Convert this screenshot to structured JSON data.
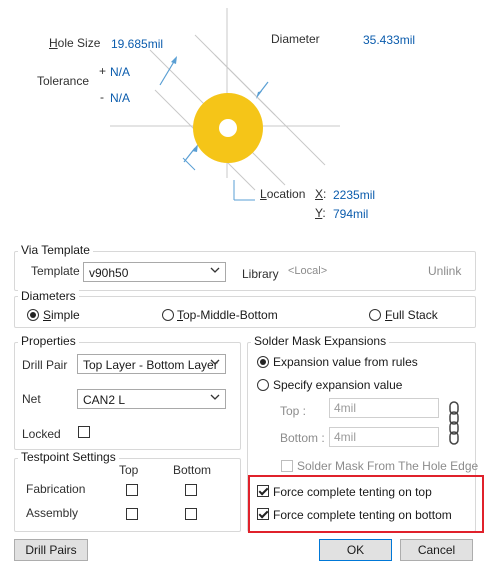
{
  "hole": {
    "hole_size_label": "Hole Size",
    "hole_size_value": "19.685mil",
    "tolerance_label": "Tolerance",
    "tol_plus_sign": "+",
    "tol_plus_value": "N/A",
    "tol_minus_sign": "-",
    "tol_minus_value": "N/A",
    "diameter_label": "Diameter",
    "diameter_value": "35.433mil",
    "location_label": "Location",
    "x_label": "X:",
    "x_value": "2235mil",
    "y_label": "Y:",
    "y_value": "794mil"
  },
  "via_template": {
    "title": "Via Template",
    "template_label": "Template",
    "template_value": "v90h50",
    "library_label": "Library",
    "library_value": "<Local>",
    "unlink_label": "Unlink"
  },
  "diameters": {
    "title": "Diameters",
    "simple": "Simple",
    "top_middle_bottom": "Top-Middle-Bottom",
    "full_stack": "Full Stack",
    "selected": "Simple"
  },
  "properties": {
    "title": "Properties",
    "drill_pair_label": "Drill Pair",
    "drill_pair_value": "Top Layer - Bottom Layer",
    "net_label": "Net",
    "net_value": "CAN2 L",
    "locked_label": "Locked",
    "locked_checked": false
  },
  "solder_mask": {
    "title": "Solder Mask Expansions",
    "rules_label": "Expansion value from rules",
    "specify_label": "Specify expansion value",
    "selected": "Expansion value from rules",
    "top_label": "Top :",
    "top_value": "4mil",
    "bottom_label": "Bottom :",
    "bottom_value": "4mil",
    "from_hole_label": "Solder Mask From The Hole Edge",
    "force_top_label": "Force complete tenting on top",
    "force_top_checked": true,
    "force_bottom_label": "Force complete tenting on bottom",
    "force_bottom_checked": true,
    "highlight_color": "#e0212b"
  },
  "testpoint": {
    "title": "Testpoint Settings",
    "col_top": "Top",
    "col_bottom": "Bottom",
    "fabrication_label": "Fabrication",
    "assembly_label": "Assembly"
  },
  "buttons": {
    "drill_pairs": "Drill Pairs",
    "ok": "OK",
    "cancel": "Cancel"
  },
  "colors": {
    "via_ring": "#f5c518",
    "link_blue": "#0b5cad",
    "accent_blue": "#0078d7"
  }
}
